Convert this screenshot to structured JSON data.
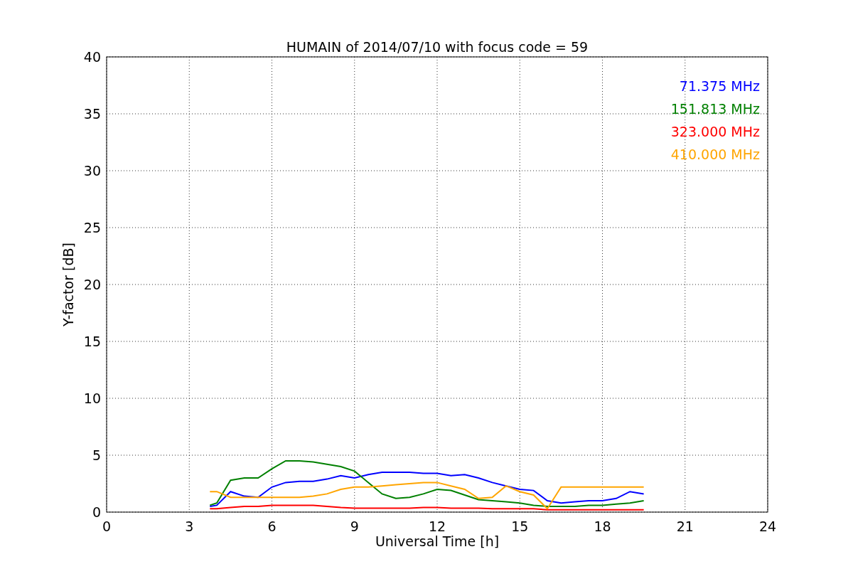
{
  "chart_data": {
    "type": "line",
    "title": "HUMAIN of 2014/07/10 with focus code = 59",
    "xlabel": "Universal Time [h]",
    "ylabel": "Y-factor [dB]",
    "x": [
      3.75,
      4,
      4.5,
      5,
      5.5,
      6,
      6.5,
      7,
      7.5,
      8,
      8.5,
      9,
      9.5,
      10,
      10.5,
      11,
      11.5,
      12,
      12.5,
      13,
      13.5,
      14,
      14.5,
      15,
      15.5,
      16,
      16.5,
      17,
      17.5,
      18,
      18.5,
      19,
      19.5
    ],
    "series": [
      {
        "name": "71.375 MHz",
        "color": "#0000ff",
        "values": [
          0.5,
          0.6,
          1.8,
          1.4,
          1.3,
          2.2,
          2.6,
          2.7,
          2.7,
          2.9,
          3.2,
          3.0,
          3.3,
          3.5,
          3.5,
          3.5,
          3.4,
          3.4,
          3.2,
          3.3,
          3.0,
          2.6,
          2.3,
          2.0,
          1.9,
          1.0,
          0.8,
          0.9,
          1.0,
          1.0,
          1.2,
          1.8,
          1.6
        ]
      },
      {
        "name": "151.813 MHz",
        "color": "#008000",
        "values": [
          0.6,
          0.8,
          2.8,
          3.0,
          3.0,
          3.8,
          4.5,
          4.5,
          4.4,
          4.2,
          4.0,
          3.6,
          2.6,
          1.6,
          1.2,
          1.3,
          1.6,
          2.0,
          1.9,
          1.5,
          1.1,
          1.0,
          0.9,
          0.8,
          0.6,
          0.5,
          0.5,
          0.5,
          0.6,
          0.6,
          0.7,
          0.8,
          1.0
        ]
      },
      {
        "name": "323.000 MHz",
        "color": "#ff0000",
        "values": [
          0.3,
          0.3,
          0.4,
          0.5,
          0.5,
          0.6,
          0.6,
          0.6,
          0.6,
          0.5,
          0.4,
          0.35,
          0.35,
          0.35,
          0.35,
          0.35,
          0.4,
          0.4,
          0.35,
          0.35,
          0.35,
          0.3,
          0.3,
          0.3,
          0.3,
          0.2,
          0.2,
          0.2,
          0.2,
          0.2,
          0.2,
          0.2,
          0.2
        ]
      },
      {
        "name": "410.000 MHz",
        "color": "#ffa500",
        "values": [
          1.8,
          1.8,
          1.3,
          1.3,
          1.3,
          1.3,
          1.3,
          1.3,
          1.4,
          1.6,
          2.0,
          2.2,
          2.2,
          2.3,
          2.4,
          2.5,
          2.6,
          2.6,
          2.3,
          2.0,
          1.2,
          1.3,
          2.3,
          1.8,
          1.5,
          0.3,
          2.2,
          2.2,
          2.2,
          2.2,
          2.2,
          2.2,
          2.2
        ]
      }
    ],
    "grid": true,
    "xlim": [
      0,
      24
    ],
    "ylim": [
      0,
      40
    ],
    "xticks": [
      0,
      3,
      6,
      9,
      12,
      15,
      18,
      21,
      24
    ],
    "yticks": [
      0,
      5,
      10,
      15,
      20,
      25,
      30,
      35,
      40
    ]
  }
}
